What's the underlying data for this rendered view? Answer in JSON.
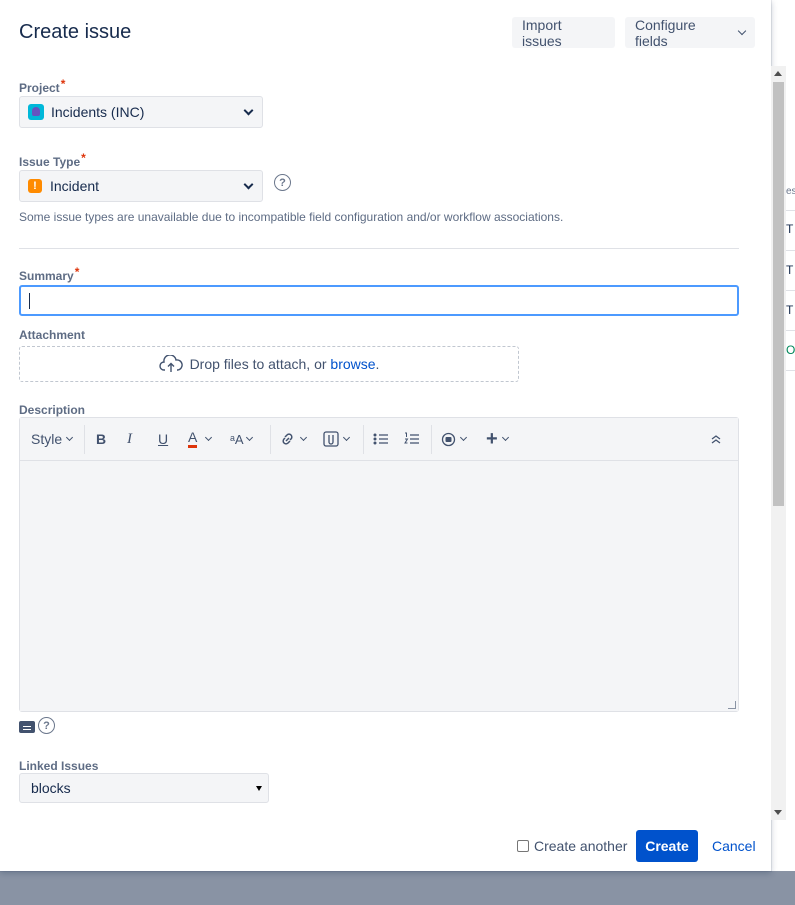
{
  "modal": {
    "title": "Create issue",
    "import_label": "Import issues",
    "configure_label": "Configure fields"
  },
  "project": {
    "label": "Project",
    "required_mark": "*",
    "value": "Incidents (INC)"
  },
  "issue_type": {
    "label": "Issue Type",
    "required_mark": "*",
    "value": "Incident",
    "icon_glyph": "!",
    "help_glyph": "?",
    "note": "Some issue types are unavailable due to incompatible field configuration and/or workflow associations."
  },
  "summary": {
    "label": "Summary",
    "required_mark": "*",
    "value": ""
  },
  "attachment": {
    "label": "Attachment",
    "drop_text": "Drop files to attach, or ",
    "browse_link": "browse",
    "trailing": "."
  },
  "description": {
    "label": "Description",
    "toolbar": {
      "style": "Style",
      "bold": "B",
      "italic": "I",
      "underline": "U",
      "text_color": "A",
      "more_formatting": "ᵃA",
      "link": "🔗",
      "attachment": "📎",
      "bullet_list": "•≡",
      "numbered_list": "1≡",
      "emoticon": "☺",
      "insert": "+",
      "collapse": "˄"
    },
    "help_glyph": "?"
  },
  "linked_issues": {
    "label": "Linked Issues",
    "value": "blocks"
  },
  "footer": {
    "create_another": "Create another",
    "create_button": "Create",
    "cancel_link": "Cancel"
  },
  "colors": {
    "primary": "#0052cc",
    "focus": "#4c9aff",
    "required": "#de350b",
    "incident": "#ff8b00",
    "overlay": "#8993a4"
  },
  "background_fragments": [
    "es",
    "T",
    "T",
    "T",
    "O"
  ]
}
